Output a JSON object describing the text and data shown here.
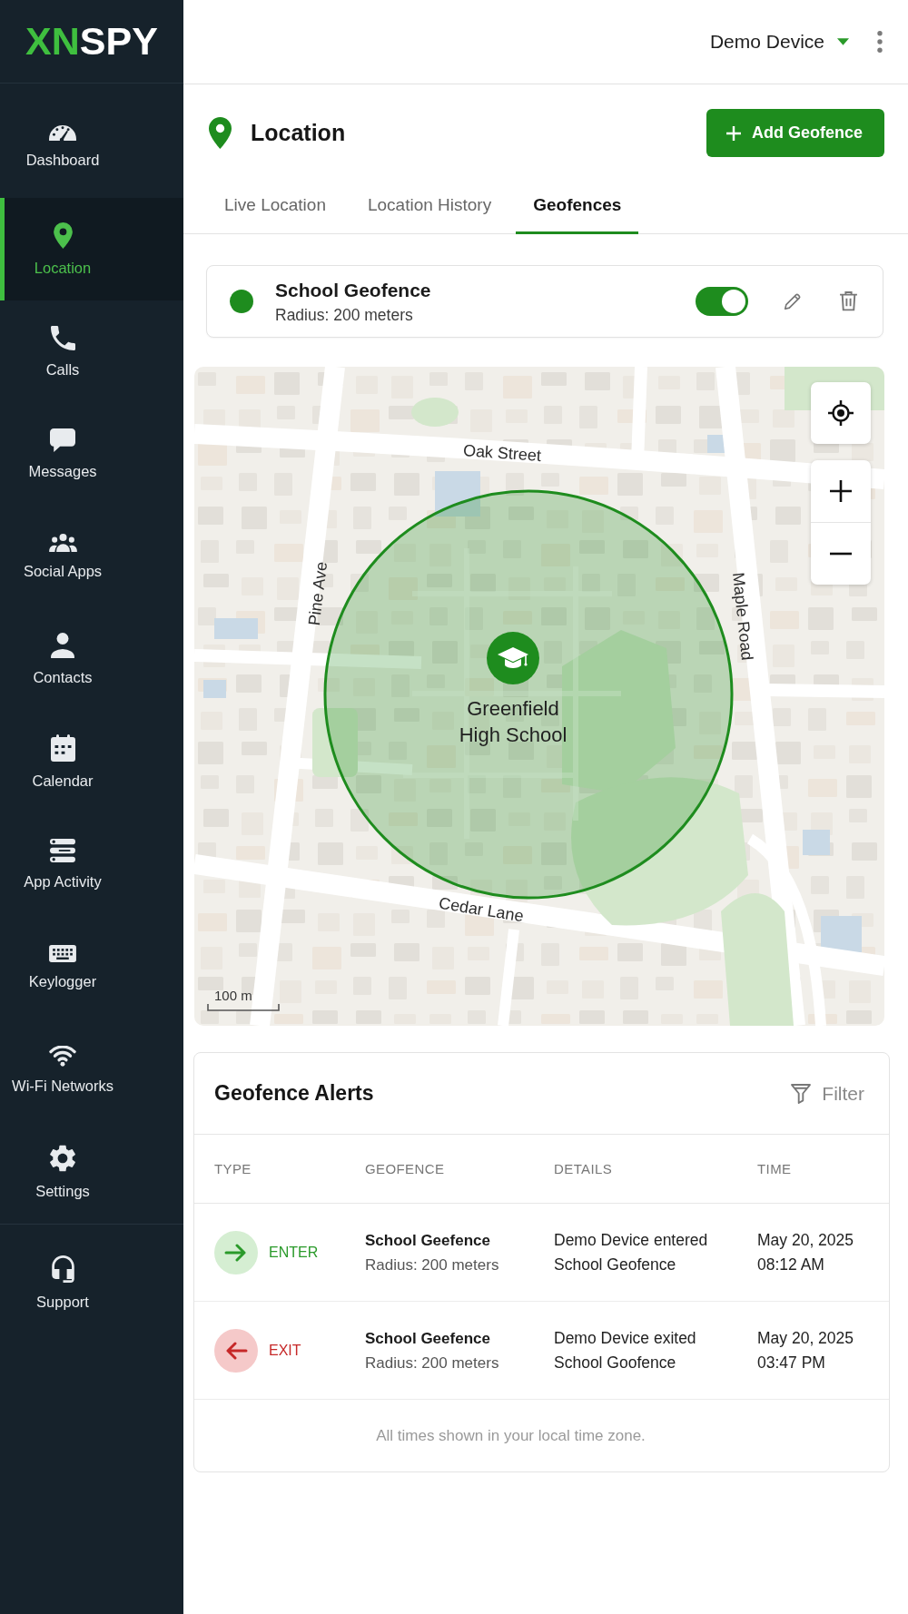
{
  "sidebar": {
    "logo": {
      "accent": "XN",
      "text": "SPY"
    },
    "items": [
      {
        "label": "Dashboard",
        "selected": false
      },
      {
        "label": "Location",
        "selected": true
      },
      {
        "label": "Calls",
        "selected": false
      },
      {
        "label": "Messages",
        "selected": false
      },
      {
        "label": "Social Apps",
        "selected": false
      },
      {
        "label": "Contacts",
        "selected": false
      },
      {
        "label": "Calendar",
        "selected": false
      },
      {
        "label": "App Activity",
        "selected": false
      },
      {
        "label": "Keylogger",
        "selected": false
      },
      {
        "label": "Wi-Fi Networks",
        "selected": false
      },
      {
        "label": "Settings",
        "selected": false
      }
    ],
    "footer_items": [
      {
        "label": "Support",
        "selected": false
      }
    ]
  },
  "header": {
    "device": "Demo Device"
  },
  "page": {
    "title": "Location",
    "action": "Add Geofence"
  },
  "tabs": [
    {
      "label": "Live Location",
      "selected": false
    },
    {
      "label": "Location History",
      "selected": false
    },
    {
      "label": "Geofences",
      "selected": true
    }
  ],
  "geofences": [
    {
      "name": "School Geofence",
      "radius": "Radius: 200 meters",
      "color": "#1e8c1e",
      "enabled": true
    }
  ],
  "map": {
    "streets": [
      {
        "name": "Oak Street"
      },
      {
        "name": "Pine Ave"
      },
      {
        "name": "Maple Road"
      },
      {
        "name": "Cedar Lane"
      }
    ],
    "place": "Greenfield High School",
    "scale": "100 m"
  },
  "alerts": {
    "title": "Geofence Alerts",
    "filter": "Filter",
    "columns": [
      "TYPE",
      "GEOFENCE",
      "DETAILS",
      "TIME"
    ],
    "rows": [
      {
        "kind": "enter",
        "type": "ENTER",
        "geofence": "School Geefence",
        "radius": "Radius: 200 meters",
        "details": "Demo Device entered School Geofence",
        "date": "May 20, 2025",
        "time": "08:12 AM"
      },
      {
        "kind": "exit",
        "type": "EXIT",
        "geofence": "School Geefence",
        "radius": "Radius: 200 meters",
        "details": "Demo Device exited School Goofence",
        "date": "May 20, 2025",
        "time": "03:47 PM"
      }
    ],
    "note": "All times shown in your local time zone."
  }
}
